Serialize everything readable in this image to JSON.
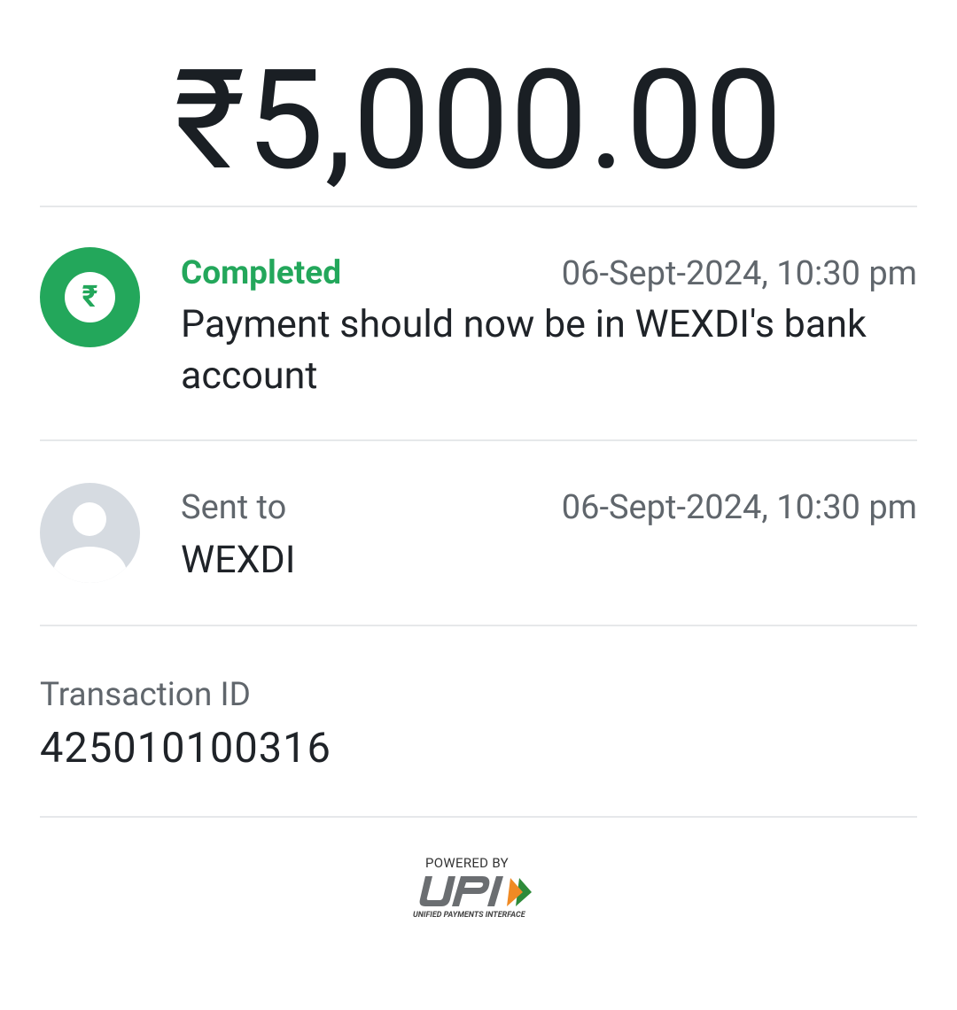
{
  "amount": "₹5,000.00",
  "status": {
    "label": "Completed",
    "timestamp": "06-Sept-2024, 10:30 pm",
    "message": "Payment should now be in WEXDI's bank account",
    "icon": "rupee-icon",
    "icon_glyph": "₹",
    "color": "#23a75b"
  },
  "recipient": {
    "label": "Sent to",
    "timestamp": "06-Sept-2024, 10:30 pm",
    "name": "WEXDI",
    "icon": "avatar-placeholder-icon"
  },
  "transaction": {
    "label": "Transaction ID",
    "id": "425010100316"
  },
  "footer": {
    "powered_by": "POWERED BY",
    "brand": "UPI",
    "tagline": "UNIFIED PAYMENTS INTERFACE"
  }
}
